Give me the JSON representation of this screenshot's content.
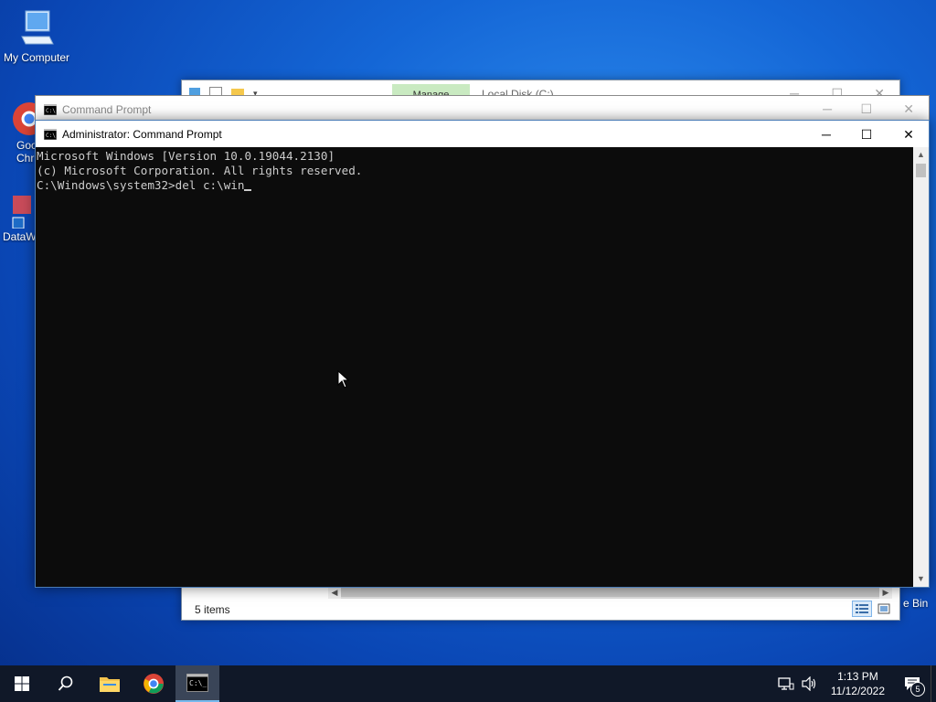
{
  "desktop": {
    "icons": [
      {
        "label": "My Computer"
      },
      {
        "label": "Goo\nChr"
      },
      {
        "label": "DataW"
      }
    ],
    "recycle_bin_partial_label": "e Bin"
  },
  "explorer": {
    "ribbon_tab": "Manage",
    "title": "Local Disk (C:)",
    "status": "5 items"
  },
  "cmd_background": {
    "title": "Command Prompt"
  },
  "cmd": {
    "title": "Administrator: Command Prompt",
    "lines": [
      "Microsoft Windows [Version 10.0.19044.2130]",
      "(c) Microsoft Corporation. All rights reserved.",
      "",
      "C:\\Windows\\system32>del c:\\win"
    ]
  },
  "taskbar": {
    "time": "1:13 PM",
    "date": "11/12/2022",
    "notification_count": "5"
  }
}
